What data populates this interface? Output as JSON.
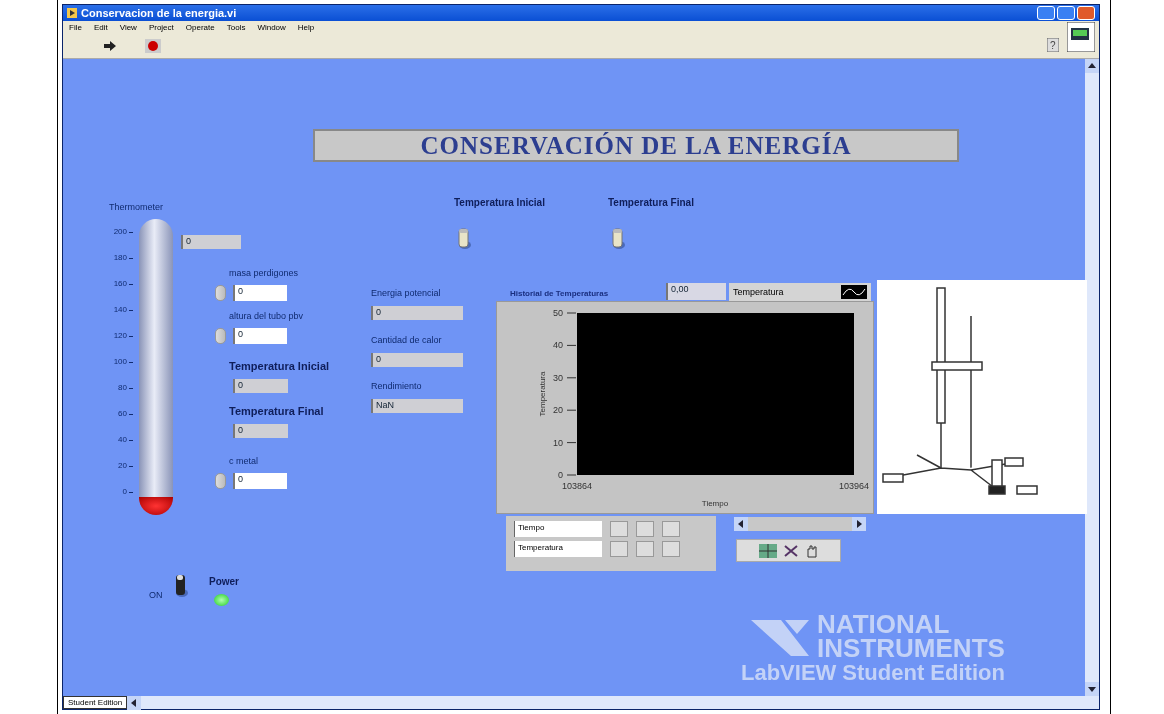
{
  "window": {
    "title": "Conservacion de la energia.vi"
  },
  "help_glyph": "?",
  "menu": [
    "File",
    "Edit",
    "View",
    "Project",
    "Operate",
    "Tools",
    "Window",
    "Help"
  ],
  "panel": {
    "title": "CONSERVACIÓN DE LA ENERGÍA",
    "thermometer": {
      "label": "Thermometer",
      "scale": [
        "200",
        "180",
        "160",
        "140",
        "120",
        "100",
        "80",
        "60",
        "40",
        "20",
        "0"
      ],
      "level": 0,
      "reading": "0"
    },
    "controls": [
      {
        "label": "masa perdigones",
        "value": "0",
        "kind": "control"
      },
      {
        "label": "altura del tubo pbv",
        "value": "0",
        "kind": "control"
      },
      {
        "label": "Temperatura Inicial",
        "value": "0",
        "kind": "indicator"
      },
      {
        "label": "Temperatura Final",
        "value": "0",
        "kind": "indicator"
      },
      {
        "label": "c metal",
        "value": "0",
        "kind": "control"
      }
    ],
    "results": [
      {
        "label": "Energia potencial",
        "value": "0"
      },
      {
        "label": "Cantidad de calor",
        "value": "0"
      },
      {
        "label": "Rendimiento",
        "value": "NaN"
      }
    ],
    "switches": [
      {
        "label": "Temperatura Inicial",
        "on": false
      },
      {
        "label": "Temperatura Final",
        "on": false
      }
    ],
    "graph": {
      "label": "Historial de Temperaturas",
      "cursor_value": "0,00",
      "plot_name": "Temperatura",
      "xlabel": "Tiempo",
      "ylabel": "Temperatura",
      "xticks": [
        "103864",
        "103964"
      ],
      "yticks": [
        "50",
        "40",
        "30",
        "20",
        "10",
        "0"
      ],
      "scale_legend": [
        "Tiempo",
        "Temperatura"
      ]
    },
    "power": {
      "switch_label": "ON",
      "on": true,
      "label": "Power",
      "lit": true
    },
    "logo": {
      "line1": "NATIONAL",
      "line2": "INSTRUMENTS",
      "line3": "LabVIEW",
      "line3b": "Student Edition"
    }
  },
  "status": {
    "tab": "Student Edition"
  }
}
